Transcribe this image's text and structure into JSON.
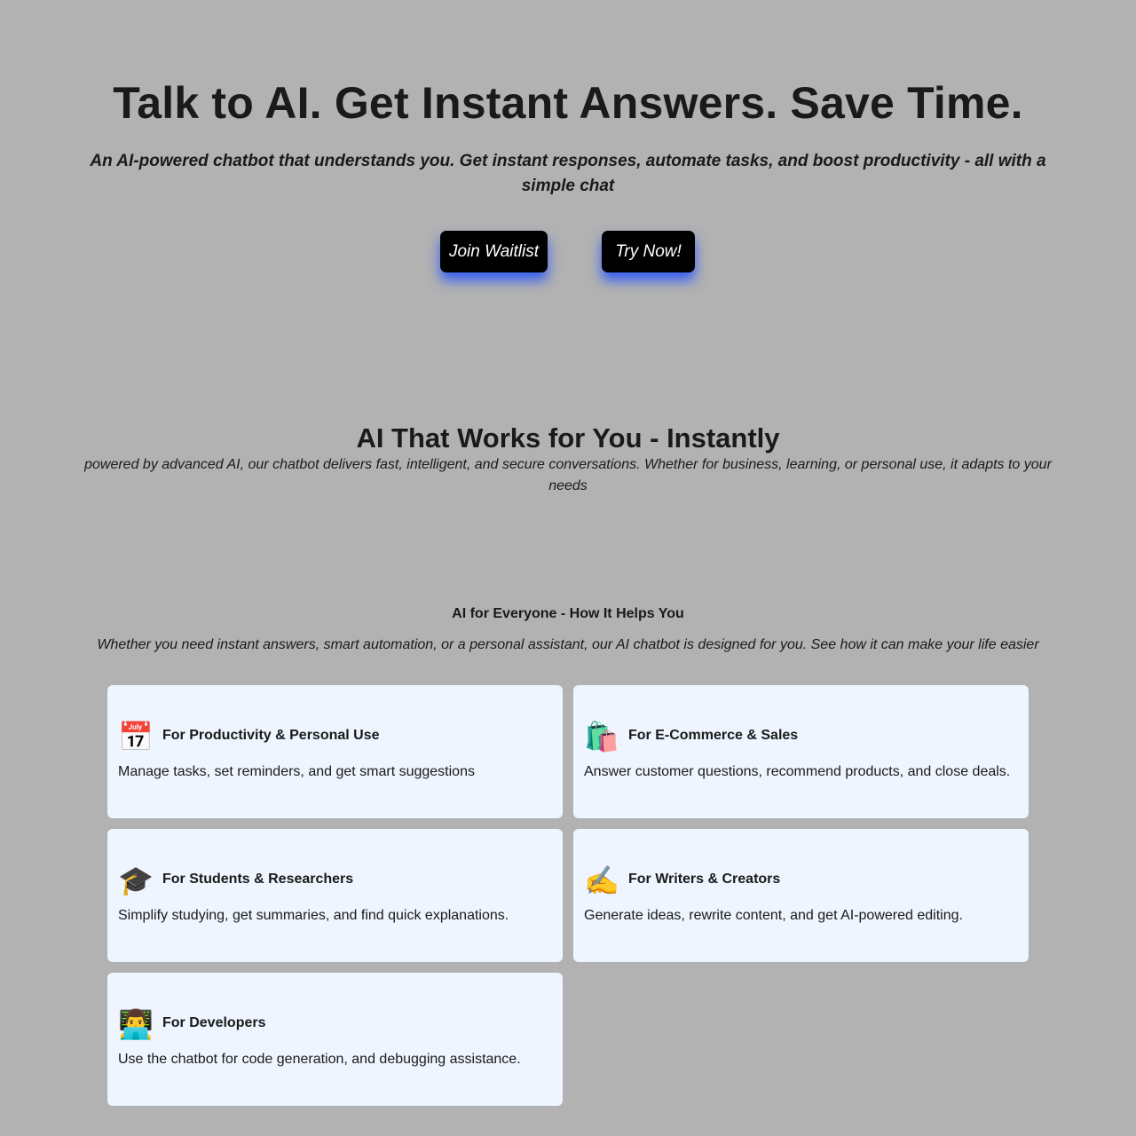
{
  "hero": {
    "title": "Talk to AI. Get Instant Answers. Save Time.",
    "subtitle": "An AI-powered chatbot that understands you. Get instant responses, automate tasks, and boost productivity - all with a simple chat",
    "join_label": "Join Waitlist",
    "try_label": "Try Now!"
  },
  "works": {
    "title": "AI That Works for You - Instantly",
    "description": "powered by advanced AI, our chatbot delivers fast, intelligent, and secure conversations. Whether for business, learning, or personal use, it adapts to your needs"
  },
  "everyone": {
    "title": "AI for Everyone - How It Helps You",
    "intro": "Whether you need instant answers, smart automation, or a personal assistant, our AI chatbot is designed for you. See how it can make your life easier",
    "cards": [
      {
        "icon": "calendar-icon",
        "emoji": "📅",
        "title": "For Productivity & Personal Use",
        "description": "Manage tasks, set reminders, and get smart suggestions"
      },
      {
        "icon": "shopping-bags-icon",
        "emoji": "🛍️",
        "title": "For E-Commerce & Sales",
        "description": "Answer customer questions, recommend products, and close deals."
      },
      {
        "icon": "graduation-cap-icon",
        "emoji": "🎓",
        "title": "For Students & Researchers",
        "description": "Simplify studying, get summaries, and find quick explanations."
      },
      {
        "icon": "writing-hand-icon",
        "emoji": "✍️",
        "title": "For Writers & Creators",
        "description": "Generate ideas, rewrite content, and get AI-powered editing."
      },
      {
        "icon": "developer-icon",
        "emoji": "👨‍💻",
        "title": "For Developers",
        "description": "Use the chatbot for code generation, and debugging assistance."
      }
    ]
  },
  "colors": {
    "page_background": "#b2b2b2",
    "card_background": "#eef5ff",
    "button_background": "#000000",
    "button_glow": "#1e50ff",
    "text": "#1a1a1a"
  }
}
